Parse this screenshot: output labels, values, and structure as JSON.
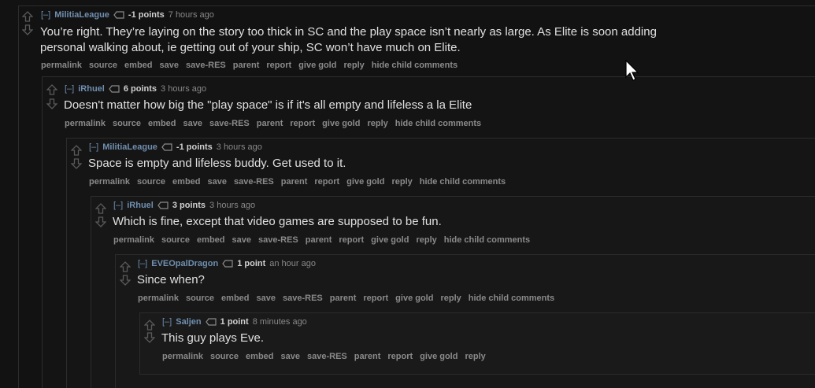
{
  "comments": [
    {
      "expand": "[–]",
      "author": "MilitiaLeague",
      "score": "-1 points",
      "time": "7 hours ago",
      "body_lines": [
        "You’re right. They’re laying on the story too thick in SC and the play space isn’t nearly as large. As Elite is soon adding",
        "personal walking about, ie getting out of your ship, SC won’t have much on Elite."
      ],
      "buttons": [
        "permalink",
        "source",
        "embed",
        "save",
        "save-RES",
        "parent",
        "report",
        "give gold",
        "reply",
        "hide child comments"
      ]
    },
    {
      "expand": "[–]",
      "author": "iRhuel",
      "score": "6 points",
      "time": "3 hours ago",
      "body_lines": [
        "Doesn't matter how big the \"play space\" is if it's all empty and lifeless a la Elite"
      ],
      "buttons": [
        "permalink",
        "source",
        "embed",
        "save",
        "save-RES",
        "parent",
        "report",
        "give gold",
        "reply",
        "hide child comments"
      ]
    },
    {
      "expand": "[–]",
      "author": "MilitiaLeague",
      "score": "-1 points",
      "time": "3 hours ago",
      "body_lines": [
        "Space is empty and lifeless buddy. Get used to it."
      ],
      "buttons": [
        "permalink",
        "source",
        "embed",
        "save",
        "save-RES",
        "parent",
        "report",
        "give gold",
        "reply",
        "hide child comments"
      ]
    },
    {
      "expand": "[–]",
      "author": "iRhuel",
      "score": "3 points",
      "time": "3 hours ago",
      "body_lines": [
        "Which is fine, except that video games are supposed to be fun."
      ],
      "buttons": [
        "permalink",
        "source",
        "embed",
        "save",
        "save-RES",
        "parent",
        "report",
        "give gold",
        "reply",
        "hide child comments"
      ]
    },
    {
      "expand": "[–]",
      "author": "EVEOpalDragon",
      "score": "1 point",
      "time": "an hour ago",
      "body_lines": [
        "Since when?"
      ],
      "buttons": [
        "permalink",
        "source",
        "embed",
        "save",
        "save-RES",
        "parent",
        "report",
        "give gold",
        "reply",
        "hide child comments"
      ]
    },
    {
      "expand": "[–]",
      "author": "Saljen",
      "score": "1 point",
      "time": "8 minutes ago",
      "body_lines": [
        "This guy plays Eve."
      ],
      "buttons": [
        "permalink",
        "source",
        "embed",
        "save",
        "save-RES",
        "parent",
        "report",
        "give gold",
        "reply"
      ]
    }
  ],
  "colors": {
    "background": "#121212",
    "author": "#6f8eaf",
    "body": "#e0e0e0",
    "buttons": "#8a8a8a"
  },
  "icons": {
    "upvote": "up-arrow-icon",
    "downvote": "down-arrow-icon",
    "tag": "tag-icon",
    "cursor": "mouse-cursor-icon"
  }
}
